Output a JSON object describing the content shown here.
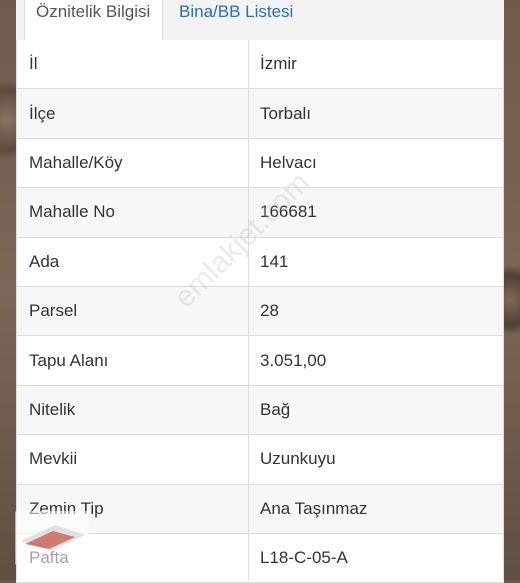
{
  "tabs": [
    {
      "label": "Öznitelik Bilgisi",
      "active": true
    },
    {
      "label": "Bina/BB Listesi",
      "active": false
    }
  ],
  "rows": [
    {
      "key": "İl",
      "value": "İzmir"
    },
    {
      "key": "İlçe",
      "value": "Torbalı"
    },
    {
      "key": "Mahalle/Köy",
      "value": "Helvacı"
    },
    {
      "key": "Mahalle No",
      "value": "166681"
    },
    {
      "key": "Ada",
      "value": "141"
    },
    {
      "key": "Parsel",
      "value": "28"
    },
    {
      "key": "Tapu Alanı",
      "value": "3.051,00"
    },
    {
      "key": "Nitelik",
      "value": "Bağ"
    },
    {
      "key": "Mevkii",
      "value": "Uzunkuyu"
    },
    {
      "key": "Zemin Tip",
      "value": "Ana Taşınmaz"
    },
    {
      "key": "Pafta",
      "value": "L18-C-05-A"
    }
  ],
  "watermark": "emlakjet.com",
  "colors": {
    "link": "#2a6fb5",
    "text": "#333333",
    "border": "#dddddd"
  }
}
